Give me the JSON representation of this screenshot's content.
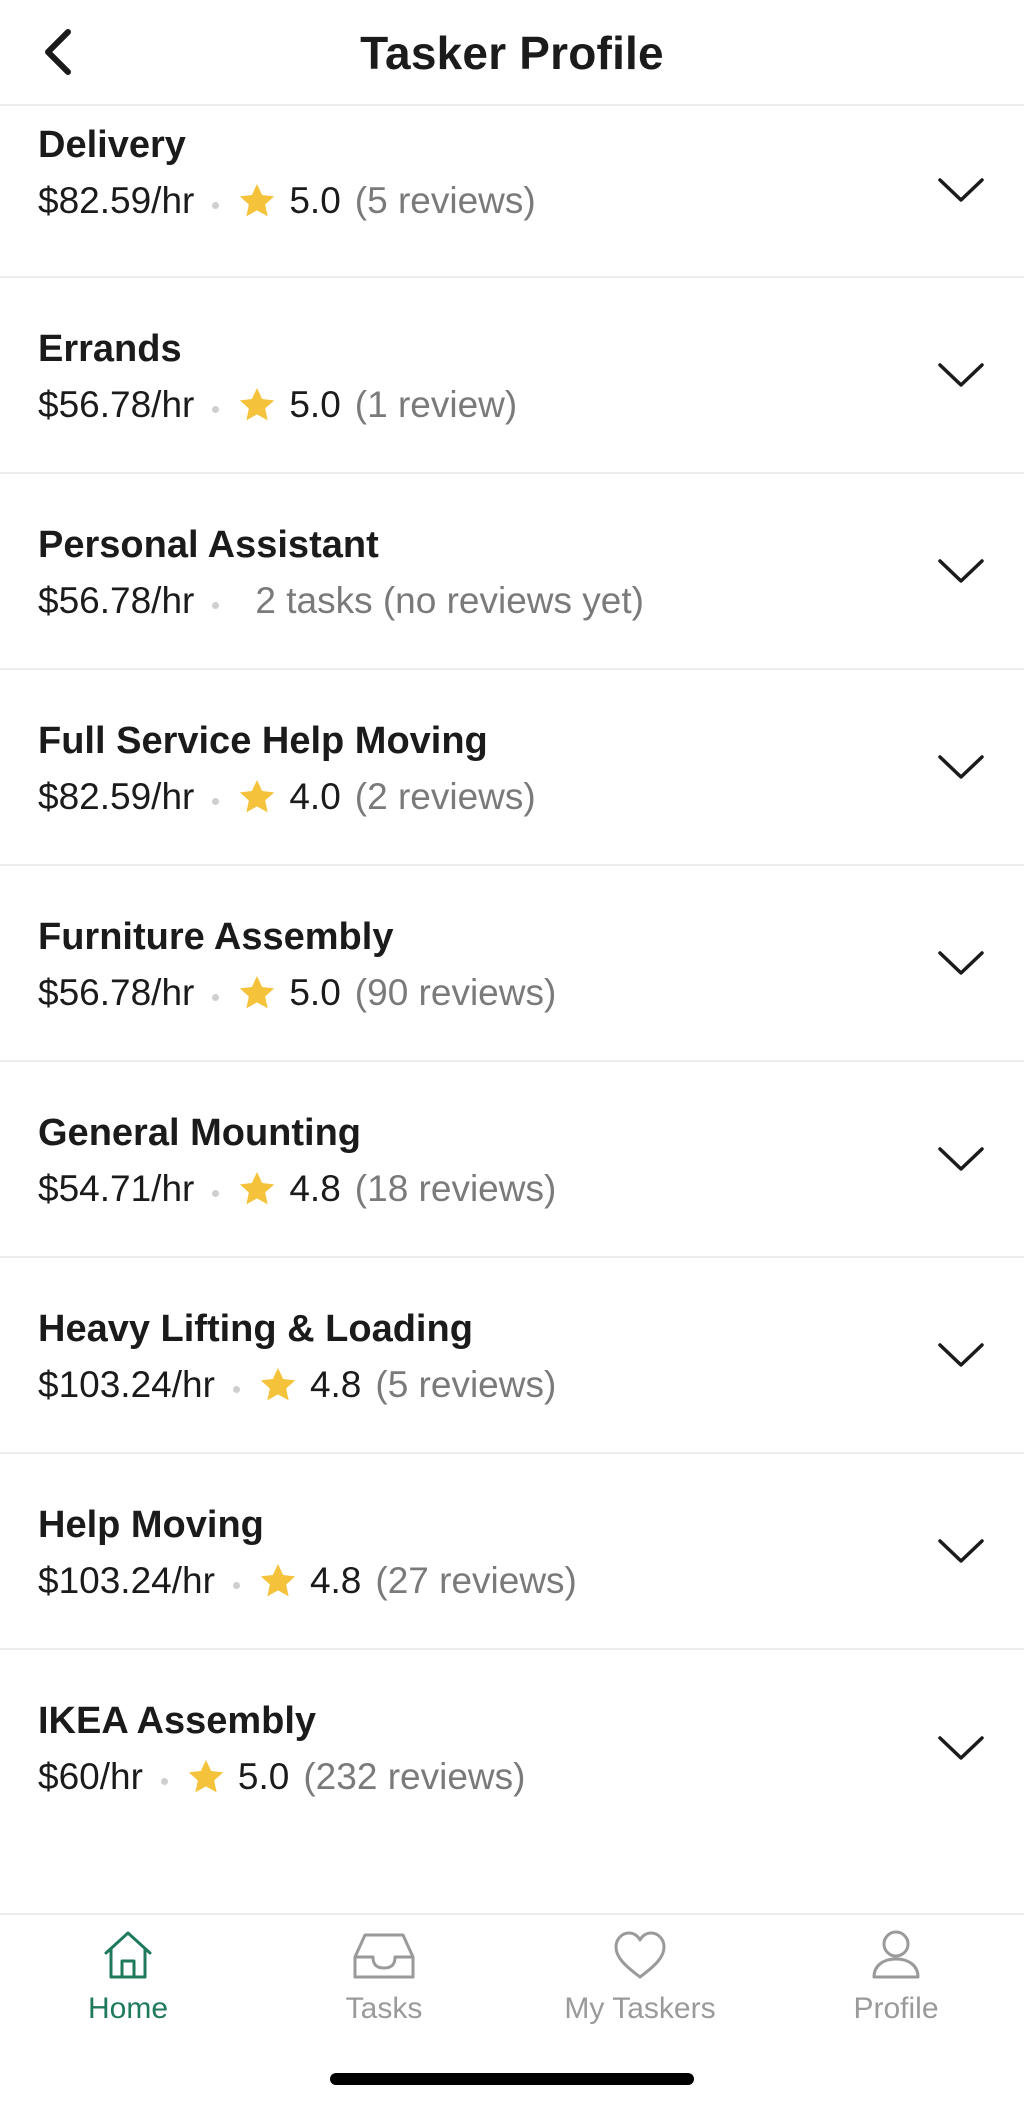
{
  "header": {
    "title": "Tasker Profile",
    "back_icon": "chevron-left-icon"
  },
  "colors": {
    "accent": "#1f7a5c",
    "star": "#f5c33b",
    "muted_text": "#7a7a7a",
    "inactive_tab": "#9a9a9a",
    "divider": "#ececec"
  },
  "services": [
    {
      "name": "Delivery",
      "rate": "$82.59/hr",
      "rating": "5.0",
      "reviews": "(5 reviews)"
    },
    {
      "name": "Errands",
      "rate": "$56.78/hr",
      "rating": "5.0",
      "reviews": "(1 review)"
    },
    {
      "name": "Personal Assistant",
      "rate": "$56.78/hr",
      "no_reviews_text": "2 tasks (no reviews yet)"
    },
    {
      "name": "Full Service Help Moving",
      "rate": "$82.59/hr",
      "rating": "4.0",
      "reviews": "(2 reviews)"
    },
    {
      "name": "Furniture Assembly",
      "rate": "$56.78/hr",
      "rating": "5.0",
      "reviews": "(90 reviews)"
    },
    {
      "name": "General Mounting",
      "rate": "$54.71/hr",
      "rating": "4.8",
      "reviews": "(18 reviews)"
    },
    {
      "name": "Heavy Lifting & Loading",
      "rate": "$103.24/hr",
      "rating": "4.8",
      "reviews": "(5 reviews)"
    },
    {
      "name": "Help Moving",
      "rate": "$103.24/hr",
      "rating": "4.8",
      "reviews": "(27 reviews)"
    },
    {
      "name": "IKEA Assembly",
      "rate": "$60/hr",
      "rating": "5.0",
      "reviews": "(232 reviews)"
    }
  ],
  "tabbar": {
    "tabs": [
      {
        "label": "Home",
        "icon": "home-icon",
        "active": true
      },
      {
        "label": "Tasks",
        "icon": "inbox-tray-icon",
        "active": false
      },
      {
        "label": "My Taskers",
        "icon": "heart-icon",
        "active": false
      },
      {
        "label": "Profile",
        "icon": "person-icon",
        "active": false
      }
    ]
  }
}
